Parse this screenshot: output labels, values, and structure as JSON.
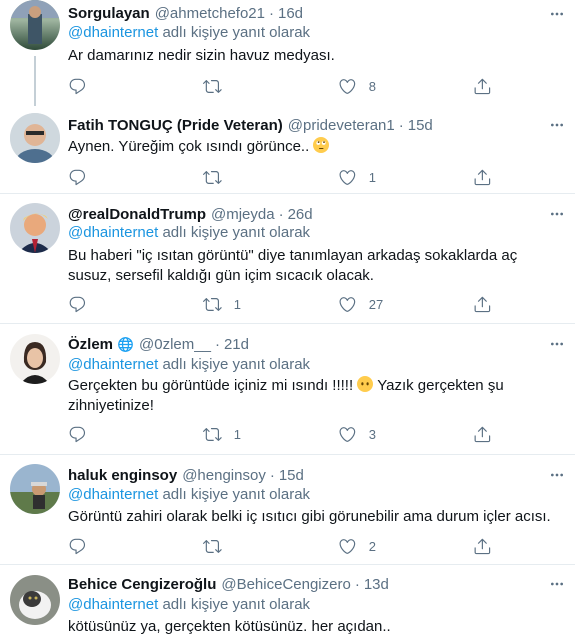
{
  "tweets": [
    {
      "name": "Sorgulayan",
      "handle": "@ahmetchefo21",
      "time": "16d",
      "reply_prefix": "",
      "reply_mention": "@dhainternet",
      "reply_suffix": " adlı kişiye yanıt olarak",
      "text": "Ar damarınız nedir sizin havuz medyası.",
      "replies": "",
      "retweets": "",
      "likes": "8"
    },
    {
      "name": "Fatih TONGUÇ (Pride Veteran)",
      "handle": "@prideveteran1",
      "time": "15d",
      "text": "Aynen. Yüreğim çok ısındı görünce..",
      "replies": "",
      "retweets": "",
      "likes": "1"
    },
    {
      "name": "@realDonaldTrump",
      "handle": "@mjeyda",
      "time": "26d",
      "reply_mention": "@dhainternet",
      "reply_suffix": " adlı kişiye yanıt olarak",
      "text": "Bu haberi \"iç ısıtan görüntü\" diye tanımlayan arkadaş sokaklarda aç susuz, sersefil kaldığı gün içim sıcacık olacak.",
      "replies": "",
      "retweets": "1",
      "likes": "27"
    },
    {
      "name": "Özlem",
      "handle": "@0zlem__",
      "time": "21d",
      "reply_mention": "@dhainternet",
      "reply_suffix": " adlı kişiye yanıt olarak",
      "text_a": "Gerçekten bu görüntüde içiniz mi ısındı !!!!! ",
      "text_b": " Yazık gerçekten şu zihniyetinize!",
      "replies": "",
      "retweets": "1",
      "likes": "3"
    },
    {
      "name": "haluk enginsoy",
      "handle": "@henginsoy",
      "time": "15d",
      "reply_mention": "@dhainternet",
      "reply_suffix": " adlı kişiye yanıt olarak",
      "text": "Görüntü zahiri olarak belki iç ısıtıcı gibi görunebilir ama durum içler acısı.",
      "replies": "",
      "retweets": "",
      "likes": "2"
    },
    {
      "name": "Behice Cengizeroğlu",
      "handle": "@BehiceCengizero",
      "time": "13d",
      "reply_mention": "@dhainternet",
      "reply_suffix": " adlı kişiye yanıt olarak",
      "text": "kötüsünüz ya, gerçekten kötüsünüz. her açıdan.."
    }
  ],
  "icons": {
    "reply": "reply-icon",
    "retweet": "retweet-icon",
    "like": "heart-icon",
    "share": "share-icon",
    "more": "more-icon",
    "globe": "globe-icon",
    "emoji_rolling": "face-with-rolling-eyes-emoji",
    "emoji_nomouth": "face-without-mouth-emoji"
  },
  "colors": {
    "link": "#1b95e0",
    "secondary": "#5b7083",
    "divider": "#e6ecf0",
    "text": "#0f1419"
  }
}
